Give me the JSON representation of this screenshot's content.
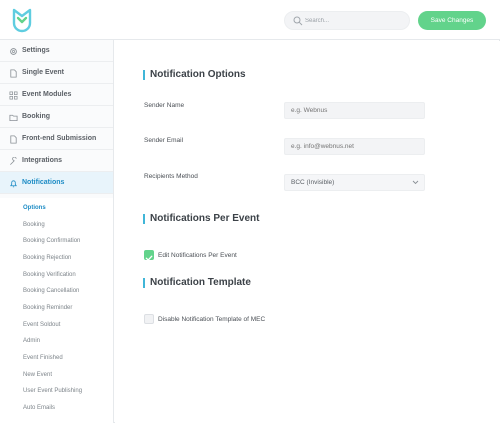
{
  "header": {
    "search_placeholder": "Search...",
    "save_label": "Save Changes",
    "brand_color": "#62d38b",
    "accent_color": "#40b6d8"
  },
  "sidebar": {
    "items": [
      {
        "label": "Settings",
        "icon": "gear-icon"
      },
      {
        "label": "Single Event",
        "icon": "document-icon"
      },
      {
        "label": "Event Modules",
        "icon": "grid-icon"
      },
      {
        "label": "Booking",
        "icon": "folder-icon"
      },
      {
        "label": "Front-end Submission",
        "icon": "document-icon"
      },
      {
        "label": "Integrations",
        "icon": "wrench-icon"
      },
      {
        "label": "Notifications",
        "icon": "bell-icon"
      }
    ],
    "sub_items": [
      "Options",
      "Booking",
      "Booking Confirmation",
      "Booking Rejection",
      "Booking Verification",
      "Booking Cancellation",
      "Booking Reminder",
      "Event Soldout",
      "Admin",
      "Event Finished",
      "New Event",
      "User Event Publishing",
      "Auto Emails"
    ]
  },
  "main": {
    "section1_title": "Notification Options",
    "sender_name_label": "Sender Name",
    "sender_name_placeholder": "e.g. Webnus",
    "sender_email_label": "Sender Email",
    "sender_email_placeholder": "e.g. info@webnus.net",
    "recipients_label": "Recipients Method",
    "recipients_value": "BCC (Invisible)",
    "section2_title": "Notifications Per Event",
    "edit_per_event_label": "Edit Notifications Per Event",
    "edit_per_event_checked": true,
    "section3_title": "Notification Template",
    "disable_template_label": "Disable Notification Template of MEC",
    "disable_template_checked": false
  }
}
